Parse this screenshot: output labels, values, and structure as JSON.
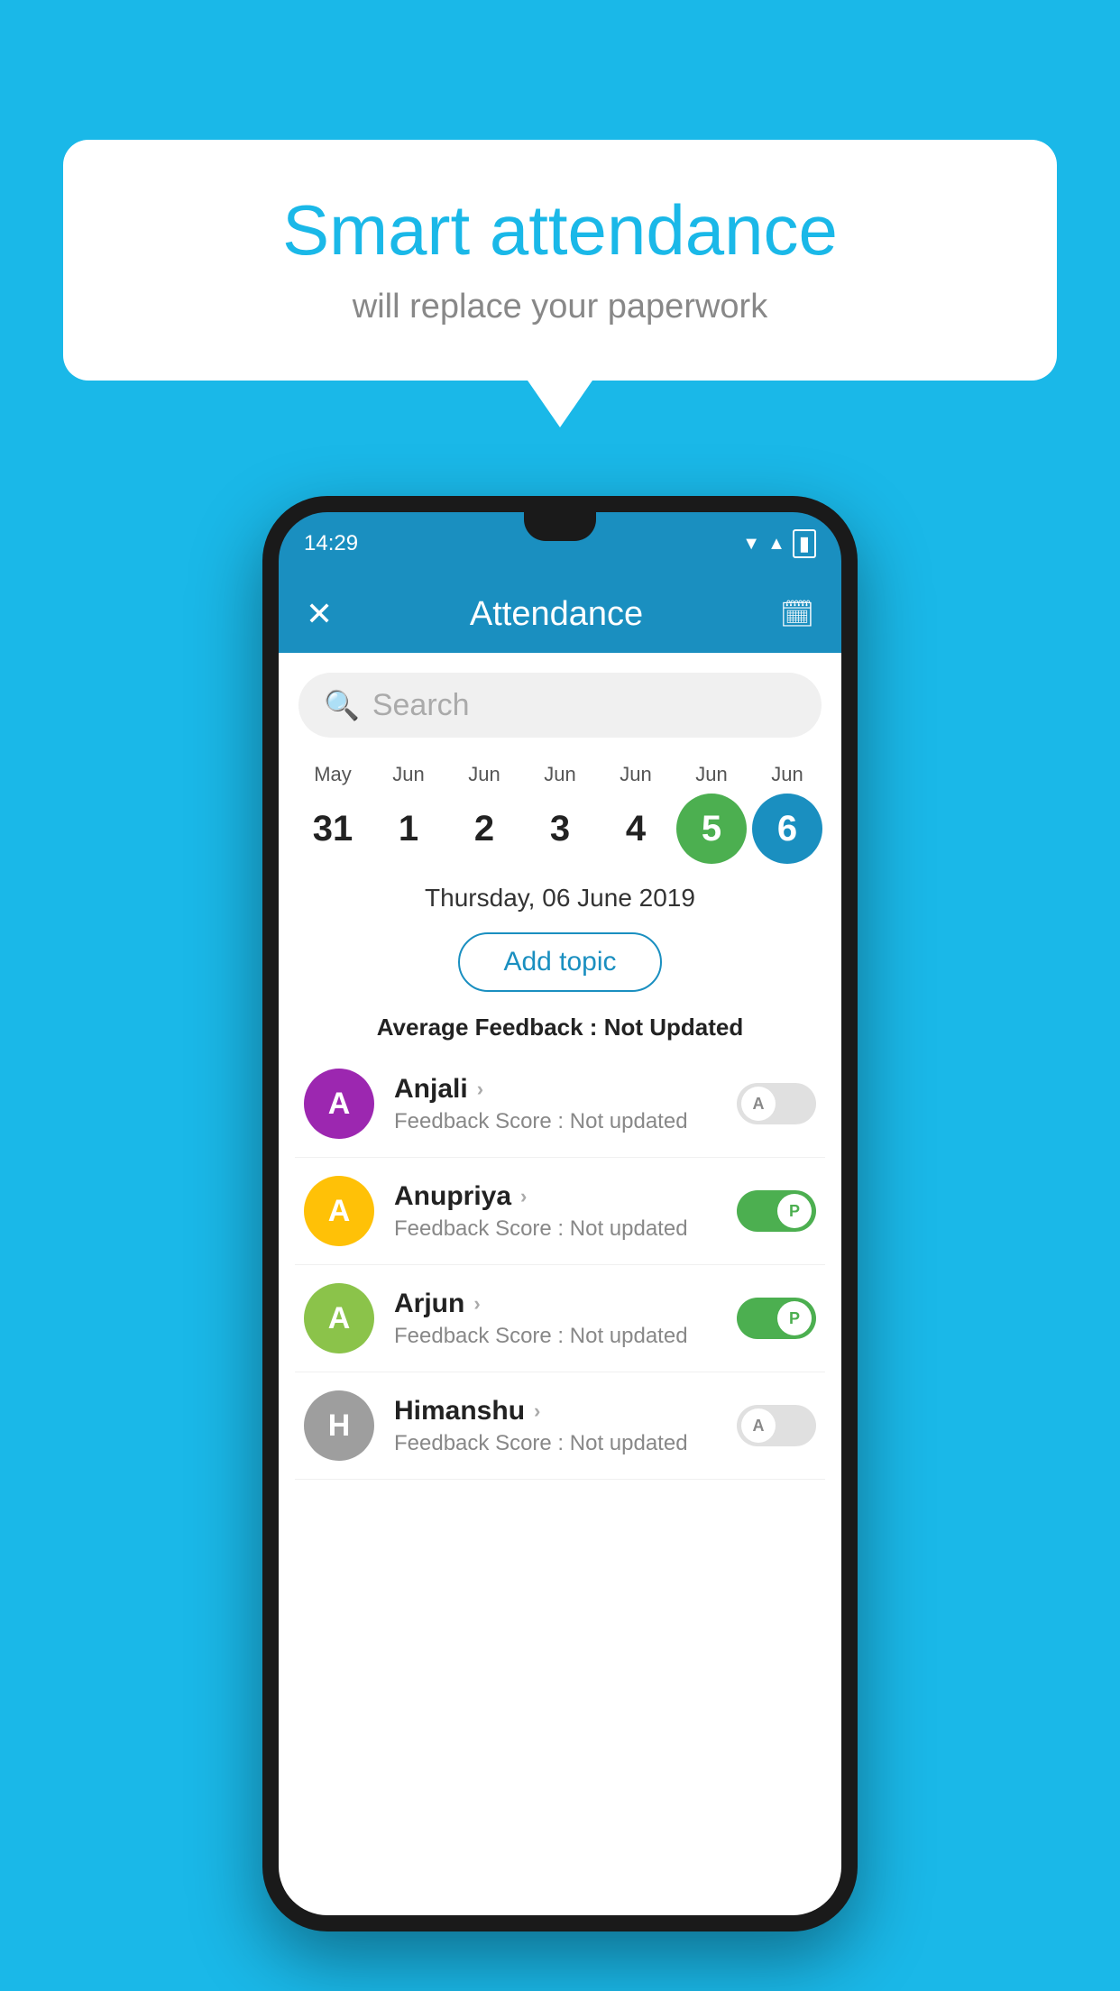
{
  "background": {
    "color": "#1ab8e8"
  },
  "speech_bubble": {
    "title": "Smart attendance",
    "subtitle": "will replace your paperwork"
  },
  "phone": {
    "status_bar": {
      "time": "14:29"
    },
    "app_bar": {
      "title": "Attendance",
      "close_icon": "✕",
      "calendar_icon": "📅"
    },
    "search": {
      "placeholder": "Search"
    },
    "calendar": {
      "days": [
        {
          "month": "May",
          "num": "31",
          "state": "normal"
        },
        {
          "month": "Jun",
          "num": "1",
          "state": "normal"
        },
        {
          "month": "Jun",
          "num": "2",
          "state": "normal"
        },
        {
          "month": "Jun",
          "num": "3",
          "state": "normal"
        },
        {
          "month": "Jun",
          "num": "4",
          "state": "normal"
        },
        {
          "month": "Jun",
          "num": "5",
          "state": "today"
        },
        {
          "month": "Jun",
          "num": "6",
          "state": "selected"
        }
      ]
    },
    "selected_date": "Thursday, 06 June 2019",
    "add_topic_label": "Add topic",
    "average_feedback": {
      "label": "Average Feedback :",
      "value": "Not Updated"
    },
    "students": [
      {
        "name": "Anjali",
        "avatar_letter": "A",
        "avatar_color": "#9c27b0",
        "score_label": "Feedback Score :",
        "score_value": "Not updated",
        "attendance": "absent",
        "toggle_letter": "A"
      },
      {
        "name": "Anupriya",
        "avatar_letter": "A",
        "avatar_color": "#ffc107",
        "score_label": "Feedback Score :",
        "score_value": "Not updated",
        "attendance": "present",
        "toggle_letter": "P"
      },
      {
        "name": "Arjun",
        "avatar_letter": "A",
        "avatar_color": "#8bc34a",
        "score_label": "Feedback Score :",
        "score_value": "Not updated",
        "attendance": "present",
        "toggle_letter": "P"
      },
      {
        "name": "Himanshu",
        "avatar_letter": "H",
        "avatar_color": "#9e9e9e",
        "score_label": "Feedback Score :",
        "score_value": "Not updated",
        "attendance": "absent",
        "toggle_letter": "A"
      }
    ]
  }
}
